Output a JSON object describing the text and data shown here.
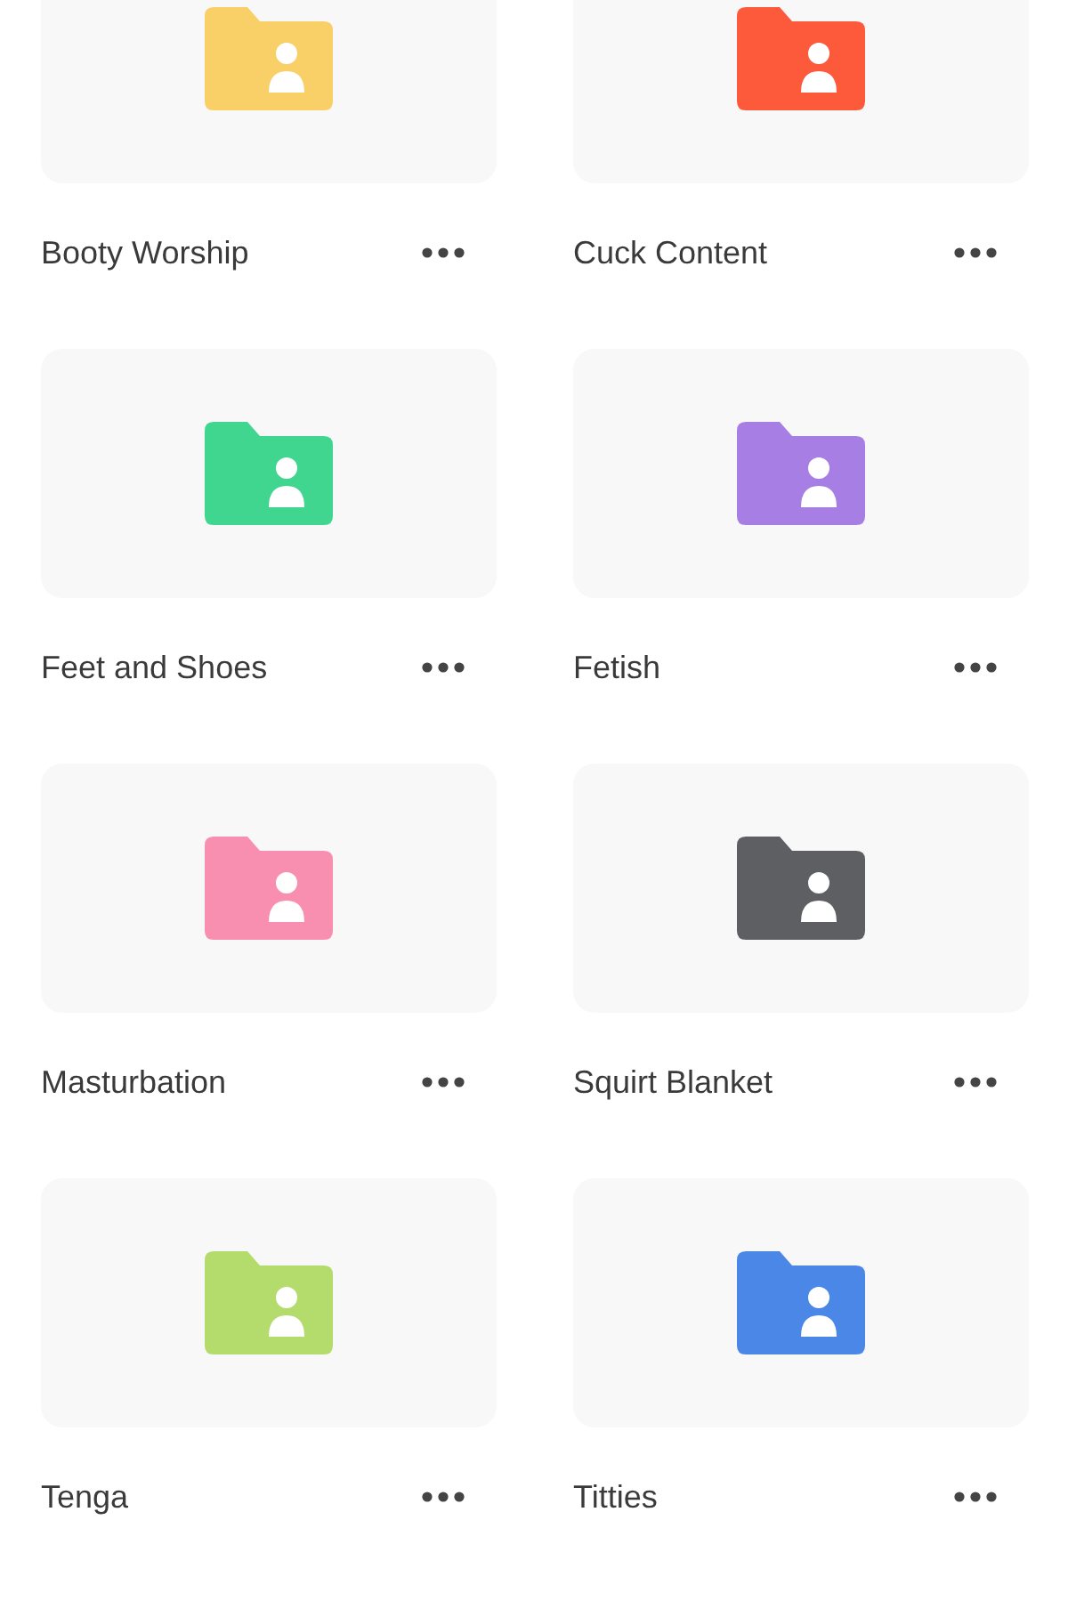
{
  "folders": [
    {
      "name": "Booty Worship",
      "color": "#f9cf67"
    },
    {
      "name": "Cuck Content",
      "color": "#fd5a3c"
    },
    {
      "name": "Feet and Shoes",
      "color": "#41d690"
    },
    {
      "name": "Fetish",
      "color": "#a77ee3"
    },
    {
      "name": "Masturbation",
      "color": "#f88fb0"
    },
    {
      "name": "Squirt Blanket",
      "color": "#5d5f63"
    },
    {
      "name": "Tenga",
      "color": "#b4dc6c"
    },
    {
      "name": "Titties",
      "color": "#4a87e6"
    }
  ]
}
